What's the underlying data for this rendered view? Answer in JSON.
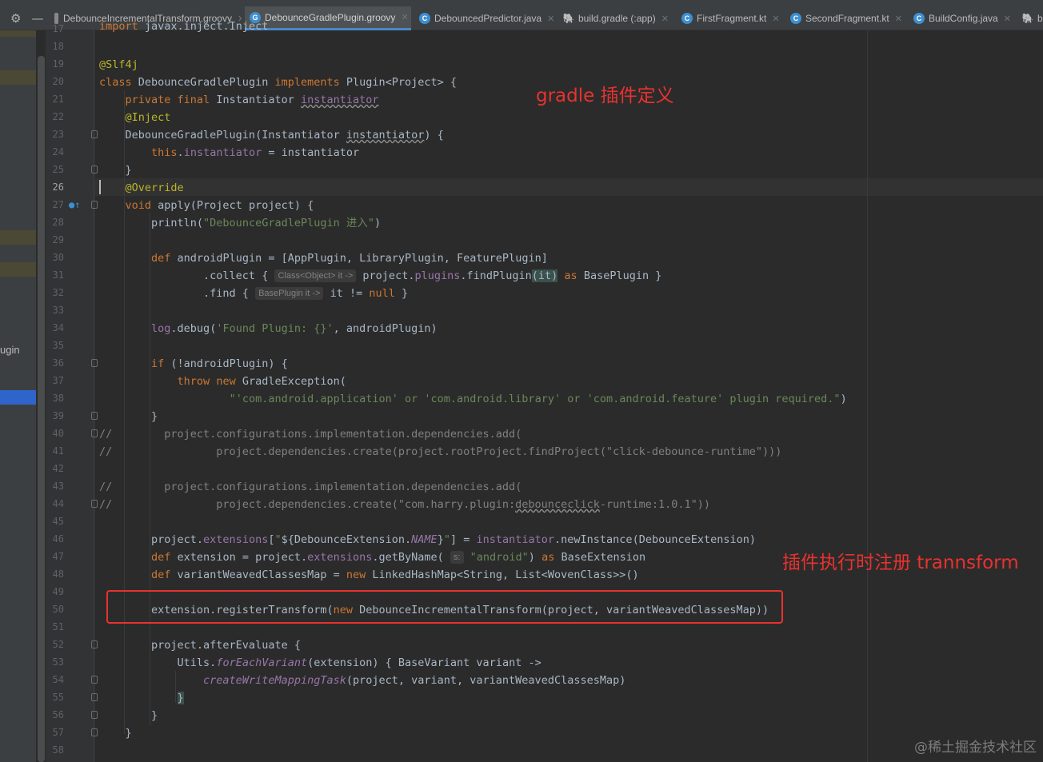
{
  "toolbar": {
    "settings_glyph": "⚙",
    "minimize_glyph": "—"
  },
  "tabs": [
    {
      "label": "DebounceIncrementalTransform.groovy",
      "icon": "groovy-file-icon"
    },
    {
      "label": "DebounceGradlePlugin.groovy",
      "icon": "groovy-file-icon",
      "active": true
    },
    {
      "label": "DebouncedPredictor.java",
      "icon": "java-class-icon"
    },
    {
      "label": "build.gradle (:app)",
      "icon": "gradle-icon"
    },
    {
      "label": "FirstFragment.kt",
      "icon": "kotlin-class-icon"
    },
    {
      "label": "SecondFragment.kt",
      "icon": "kotlin-class-icon"
    },
    {
      "label": "BuildConfig.java",
      "icon": "java-class-icon"
    },
    {
      "label": "b",
      "icon": "gradle-icon"
    }
  ],
  "left_panel": {
    "partial_label": "ugin"
  },
  "editor": {
    "current_line": 26,
    "line_numbers": [
      "17",
      "18",
      "19",
      "20",
      "21",
      "22",
      "23",
      "24",
      "25",
      "26",
      "27",
      "28",
      "29",
      "30",
      "31",
      "32",
      "33",
      "34",
      "35",
      "36",
      "37",
      "38",
      "39",
      "40",
      "41",
      "42",
      "43",
      "44",
      "45",
      "46",
      "47",
      "48",
      "49",
      "50",
      "51",
      "52",
      "53",
      "54",
      "55",
      "56",
      "57",
      "58"
    ],
    "hints": {
      "collect": "Class<Object> it ->",
      "find": "BasePlugin it ->",
      "getByName": "s:"
    }
  },
  "annotations": {
    "plugin_definition": "gradle 插件定义",
    "register_transform": "插件执行时注册 trannsform"
  },
  "watermark": "@稀土掘金技术社区",
  "colors": {
    "keyword": "#cc7832",
    "annotation": "#bbb529",
    "string": "#6a8759",
    "comment": "#808080",
    "field": "#9876aa",
    "highlight_red": "#e8322f"
  }
}
